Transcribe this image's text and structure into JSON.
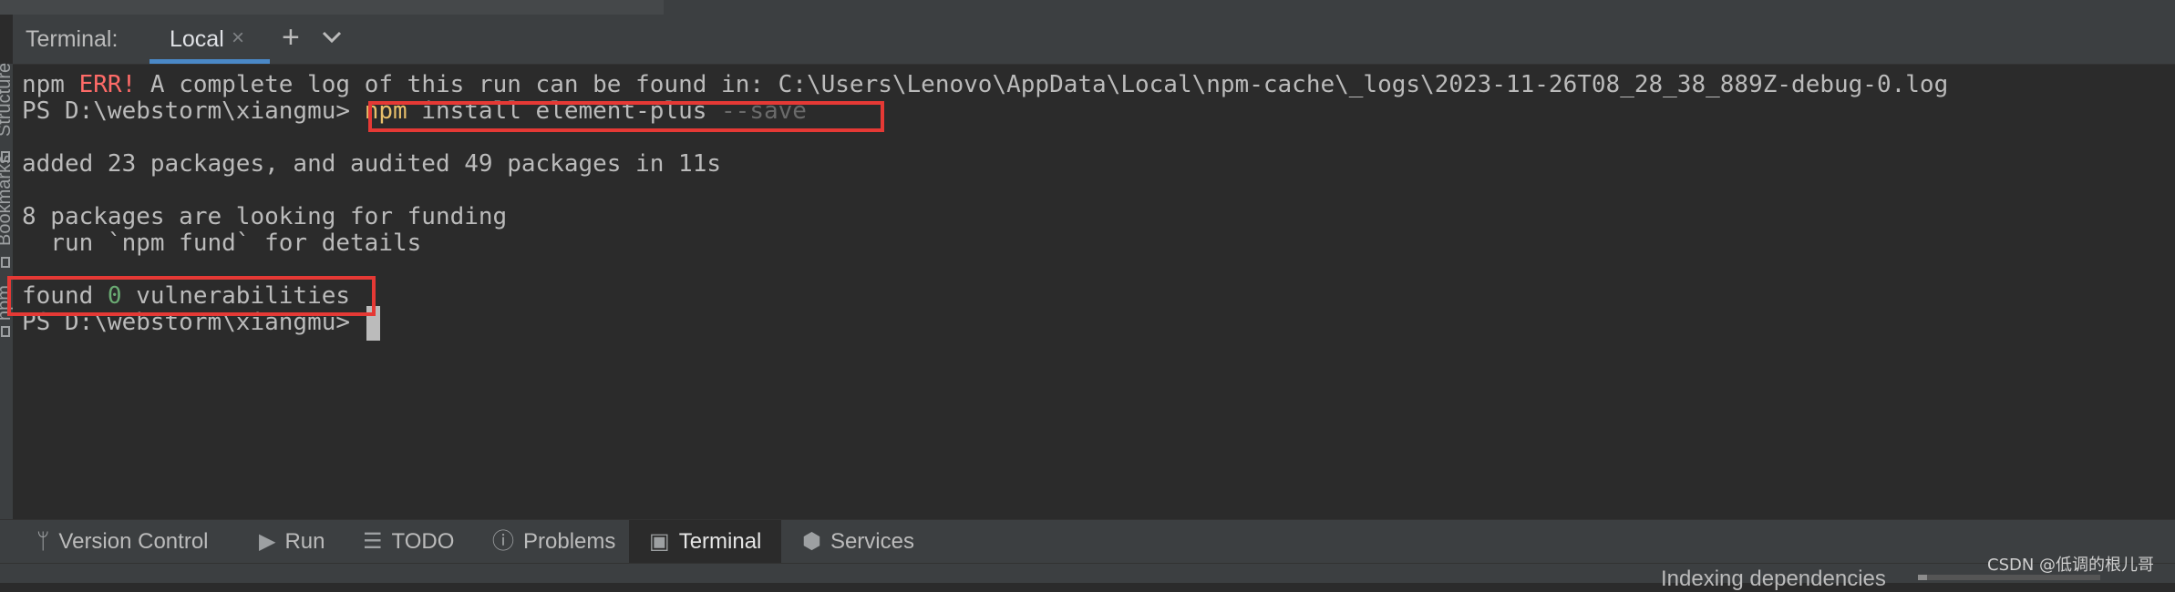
{
  "header": {
    "title": "Terminal:",
    "tab_label": "Local",
    "close_glyph": "×",
    "new_tab_glyph": "+"
  },
  "side_labels": {
    "structure": "Structure",
    "bookmarks": "Bookmarks",
    "npm": "npm"
  },
  "terminal": {
    "line1_prefix": "npm ",
    "line1_err": "ERR!",
    "line1_rest": " A complete log of this run can be found in: C:\\Users\\Lenovo\\AppData\\Local\\npm-cache\\_logs\\2023-11-26T08_28_38_889Z-debug-0.log",
    "prompt": "PS D:\\webstorm\\xiangmu> ",
    "cmd_npm": "npm",
    "cmd_args": " install element-plus ",
    "cmd_flag": "--save",
    "added_line": "added 23 packages, and audited 49 packages in 11s",
    "funding_line": "8 packages are looking for funding",
    "fund_detail_line": "  run `npm fund` for details",
    "found_prefix": "found ",
    "found_count": "0",
    "found_suffix": " vulnerabilities",
    "final_prompt": "PS D:\\webstorm\\xiangmu> "
  },
  "bottom_tools": [
    {
      "label": "Version Control",
      "icon": "branch-icon"
    },
    {
      "label": "Run",
      "icon": "play-icon"
    },
    {
      "label": "TODO",
      "icon": "list-icon"
    },
    {
      "label": "Problems",
      "icon": "info-icon"
    },
    {
      "label": "Terminal",
      "icon": "terminal-icon"
    },
    {
      "label": "Services",
      "icon": "services-icon"
    }
  ],
  "status": {
    "indexing": "Indexing dependencies"
  },
  "watermark": "CSDN @低调的根儿哥",
  "colors": {
    "accent": "#4a88c7",
    "error": "#ff6b68",
    "command": "#e8bf6a",
    "number": "#6aab73",
    "highlight_box": "#e53935"
  }
}
